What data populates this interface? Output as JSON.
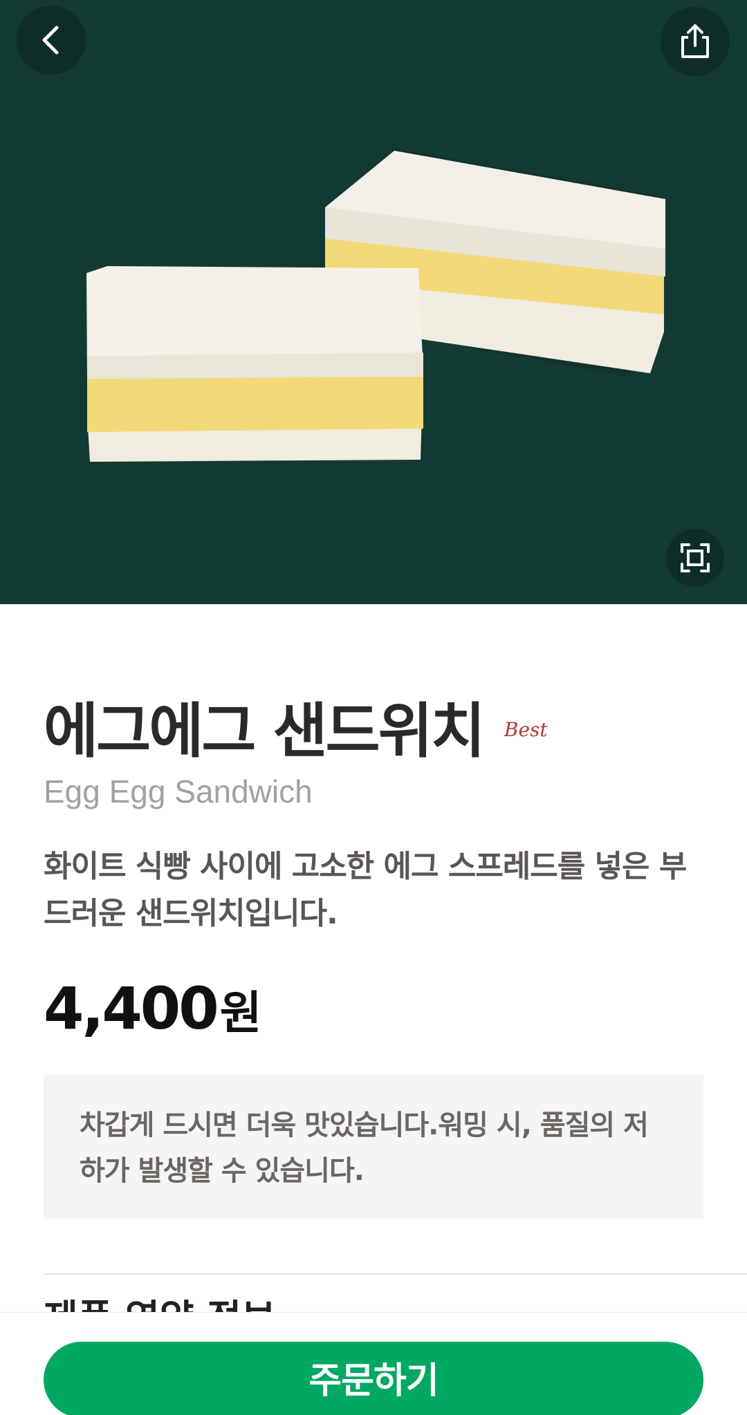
{
  "hero": {
    "background": "#133a32",
    "image_alt": "egg-sandwich-photo",
    "icons": {
      "back": "chevron-left-icon",
      "share": "share-icon",
      "zoom": "expand-icon"
    }
  },
  "product": {
    "name_ko": "에그에그 샌드위치",
    "badge": "Best",
    "name_en": "Egg Egg Sandwich",
    "description": "화이트 식빵 사이에 고소한 에그 스프레드를 넣은 부드러운 샌드위치입니다.",
    "price": "4,400",
    "currency": "원",
    "notice": "차갑게 드시면 더욱 맛있습니다.워밍 시, 품질의 저하가 발생할 수 있습니다.",
    "next_section_peek": "제품 영양 정보"
  },
  "bottom": {
    "order_label": "주문하기",
    "accent": "#00a862"
  }
}
